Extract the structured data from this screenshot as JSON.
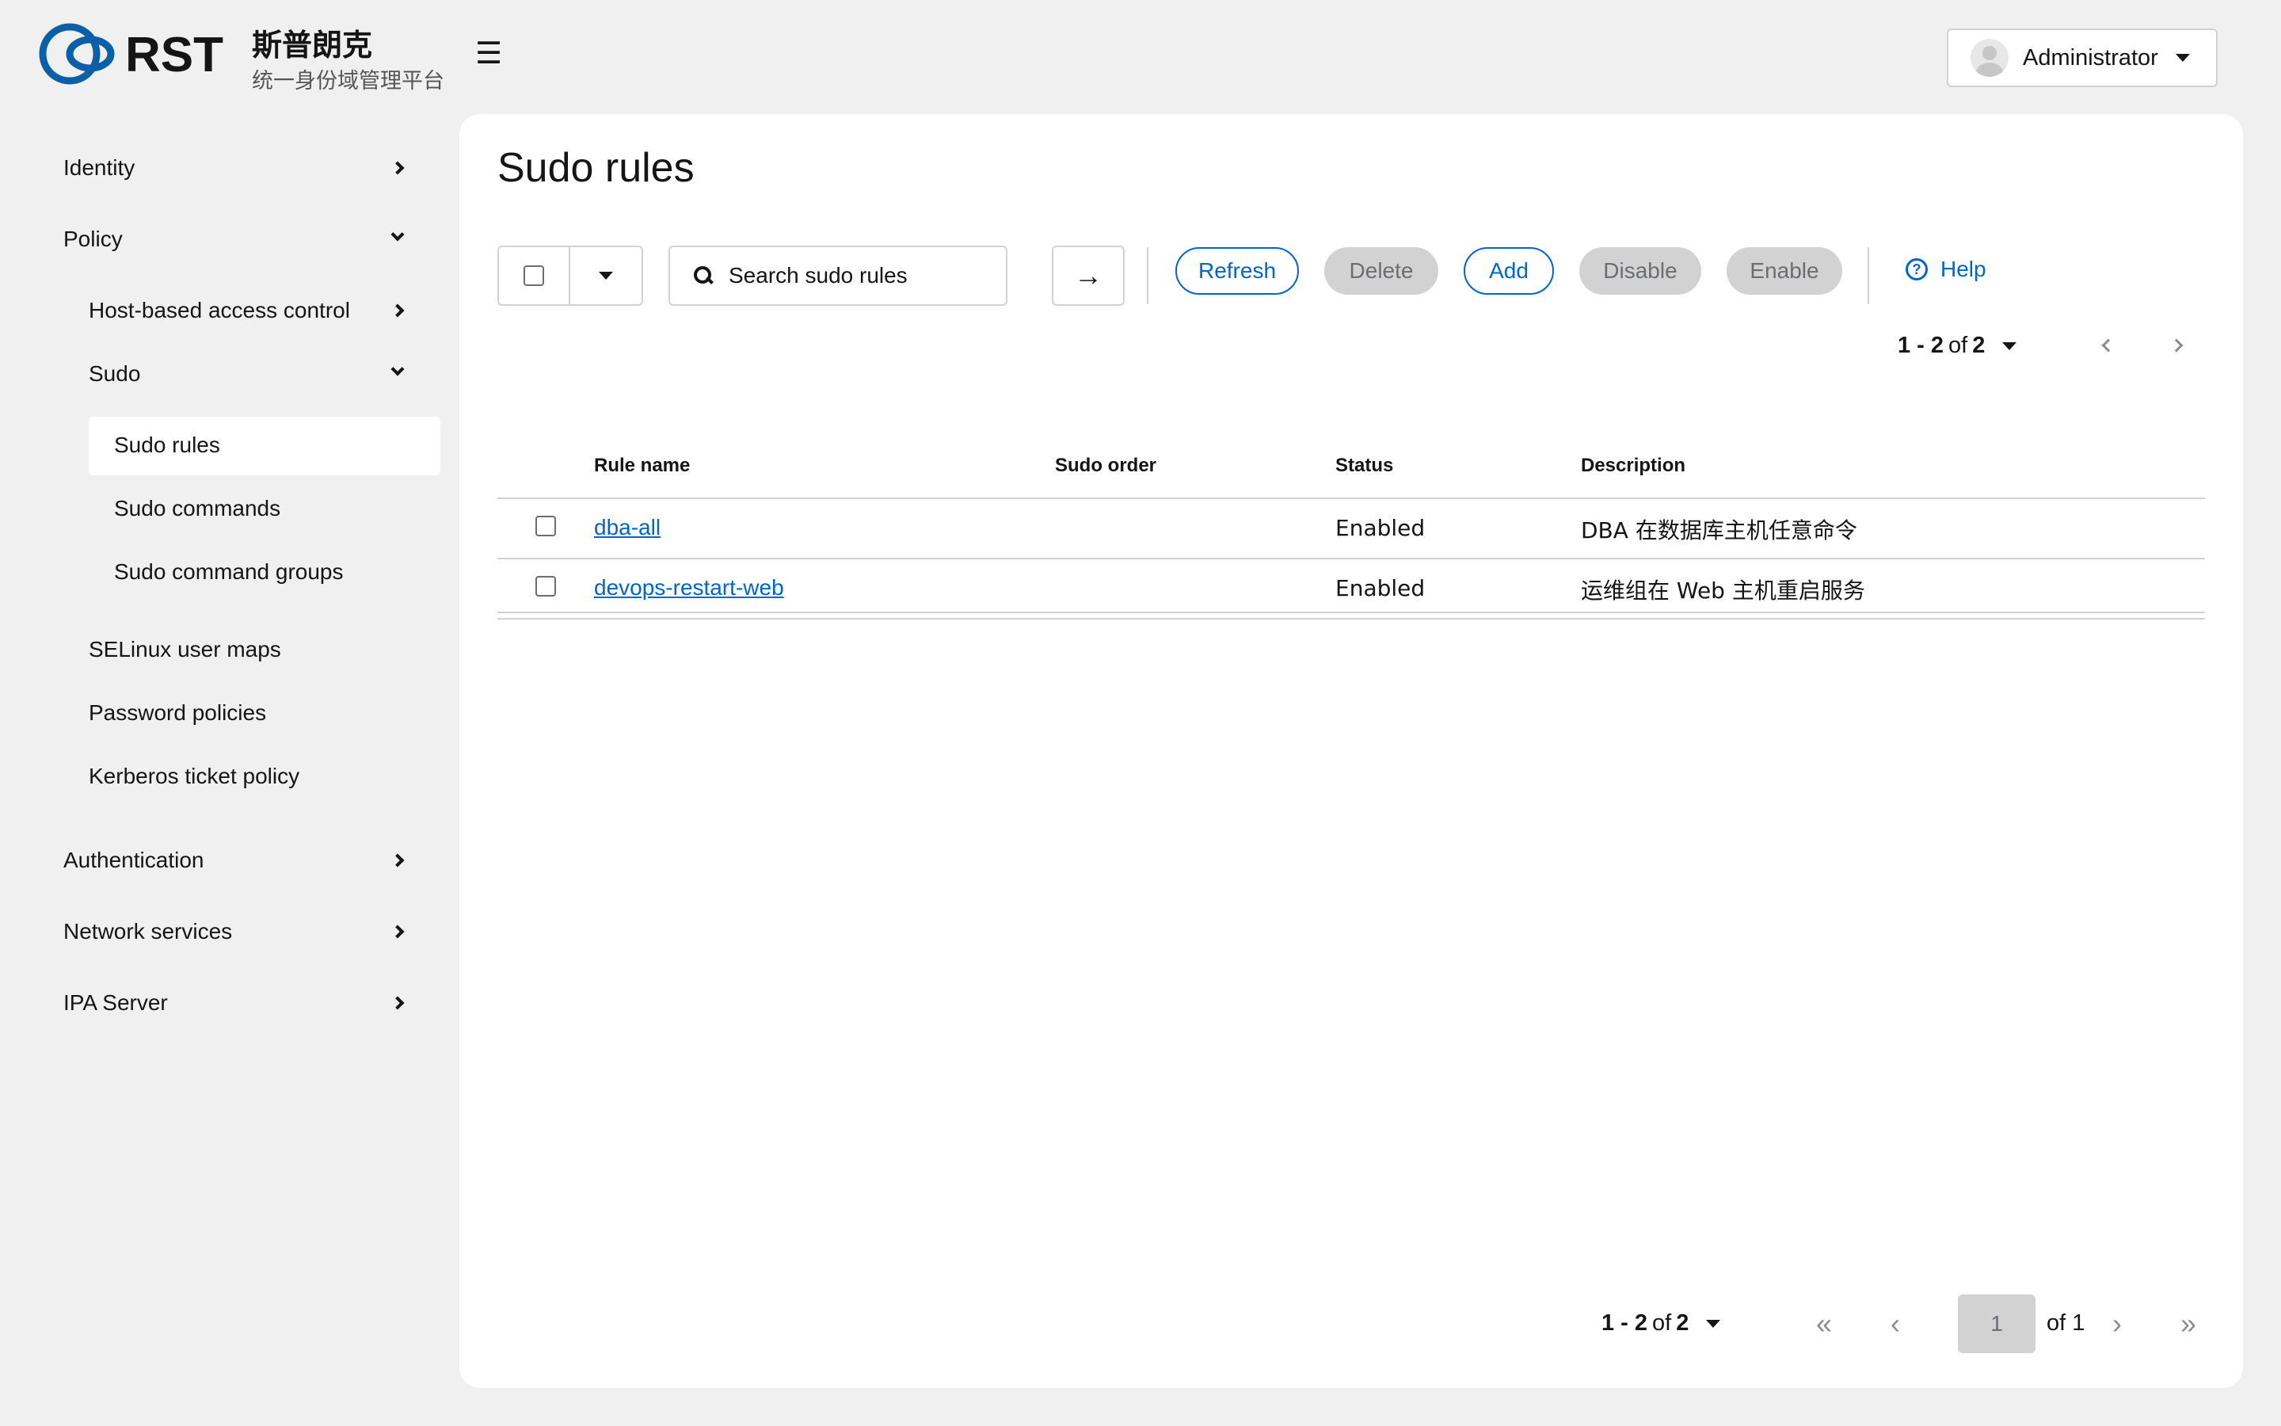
{
  "header": {
    "brand_logo_text": "RST",
    "brand_name": "斯普朗克",
    "brand_subtitle": "统一身份域管理平台",
    "menu_glyph": "☰",
    "user_name": "Administrator",
    "accent_color": "#0066cc"
  },
  "sidebar": {
    "items": [
      {
        "label": "Identity",
        "icon": "chevron-right-icon"
      },
      {
        "label": "Policy",
        "icon": "chevron-down-icon"
      },
      {
        "label": "Host-based access control",
        "icon": "chevron-right-icon"
      },
      {
        "label": "Sudo",
        "icon": "chevron-down-icon"
      },
      {
        "label": "Sudo rules",
        "active": true
      },
      {
        "label": "Sudo commands"
      },
      {
        "label": "Sudo command groups"
      },
      {
        "label": "SELinux user maps"
      },
      {
        "label": "Password policies"
      },
      {
        "label": "Kerberos ticket policy"
      },
      {
        "label": "Authentication",
        "icon": "chevron-right-icon"
      },
      {
        "label": "Network services",
        "icon": "chevron-right-icon"
      },
      {
        "label": "IPA Server",
        "icon": "chevron-right-icon"
      }
    ]
  },
  "main": {
    "title": "Sudo rules",
    "search_placeholder": "Search sudo rules",
    "search_go_glyph": "→",
    "buttons": {
      "refresh": "Refresh",
      "delete": "Delete",
      "add": "Add",
      "disable": "Disable",
      "enable": "Enable",
      "help": "Help",
      "help_glyph": "?"
    },
    "pagination_top": {
      "range": "1 - 2",
      "of_word": "of",
      "total": "2"
    },
    "table": {
      "columns": [
        "Rule name",
        "Sudo order",
        "Status",
        "Description"
      ],
      "rows": [
        {
          "name": "dba-all",
          "order": "",
          "status": "Enabled",
          "description": "DBA 在数据库主机任意命令"
        },
        {
          "name": "devops-restart-web",
          "order": "",
          "status": "Enabled",
          "description": "运维组在 Web 主机重启服务"
        }
      ]
    },
    "pagination_bottom": {
      "range": "1 - 2",
      "of_word": "of",
      "total": "2",
      "current_page": "1",
      "of_pages": "of 1",
      "first_glyph": "«",
      "prev_glyph": "‹",
      "next_glyph": "›",
      "last_glyph": "»"
    }
  }
}
